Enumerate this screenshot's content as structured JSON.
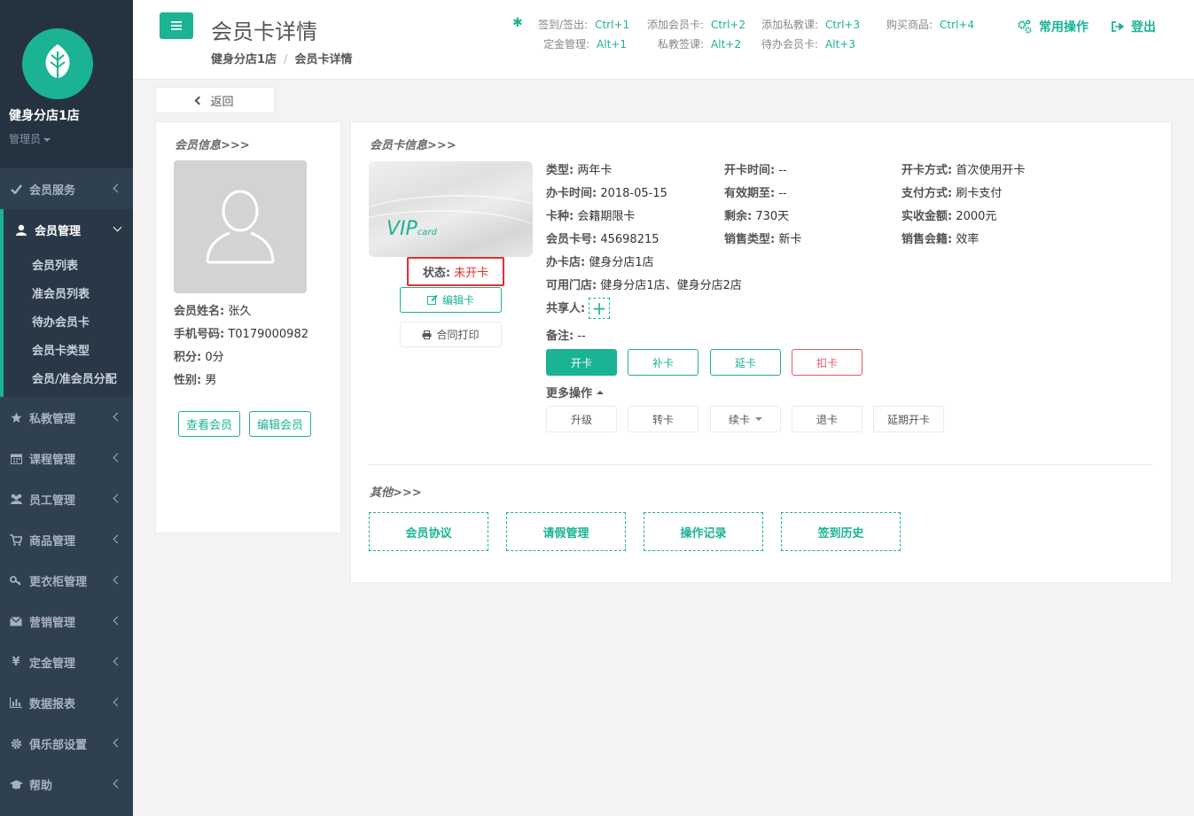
{
  "sidebar": {
    "store_name": "健身分店1店",
    "role": "管理员",
    "items": [
      {
        "label": "会员服务"
      },
      {
        "label": "会员管理"
      },
      {
        "label": "私教管理"
      },
      {
        "label": "课程管理"
      },
      {
        "label": "员工管理"
      },
      {
        "label": "商品管理"
      },
      {
        "label": "更衣柜管理"
      },
      {
        "label": "营销管理"
      },
      {
        "label": "定金管理"
      },
      {
        "label": "数据报表"
      },
      {
        "label": "俱乐部设置"
      },
      {
        "label": "帮助"
      }
    ],
    "member_sub": [
      "会员列表",
      "准会员列表",
      "待办会员卡",
      "会员卡类型",
      "会员/准会员分配"
    ]
  },
  "header": {
    "title": "会员卡详情",
    "breadcrumb": [
      "健身分店1店",
      "/",
      "会员卡详情"
    ],
    "shortcuts": [
      {
        "label": "签到/签出:",
        "key": "Ctrl+1"
      },
      {
        "label": "添加会员卡:",
        "key": "Ctrl+2"
      },
      {
        "label": "添加私教课:",
        "key": "Ctrl+3"
      },
      {
        "label": "购买商品:",
        "key": "Ctrl+4"
      },
      {
        "label": "定金管理:",
        "key": "Alt+1"
      },
      {
        "label": "私教签课:",
        "key": "Alt+2"
      },
      {
        "label": "待办会员卡:",
        "key": "Alt+3"
      }
    ],
    "common_ops": "常用操作",
    "logout": "登出"
  },
  "back_label": "返回",
  "member": {
    "section_title": "会员信息>>>",
    "name_label": "会员姓名:",
    "name": "张久",
    "phone_label": "手机号码:",
    "phone": "T0179000982",
    "points_label": "积分:",
    "points": "0分",
    "gender_label": "性别:",
    "gender": "男",
    "view_btn": "查看会员",
    "edit_btn": "编辑会员"
  },
  "card": {
    "section_title": "会员卡信息>>>",
    "vip_text": "VIP",
    "vip_sub": "card",
    "status_label": "状态:",
    "status": "未开卡",
    "edit_btn": "编辑卡",
    "print_btn": "合同打印",
    "fields": {
      "type": {
        "label": "类型:",
        "value": "两年卡"
      },
      "open_time": {
        "label": "开卡时间:",
        "value": "--"
      },
      "open_mode": {
        "label": "开卡方式:",
        "value": "首次使用开卡"
      },
      "issue_time": {
        "label": "办卡时间:",
        "value": "2018-05-15"
      },
      "valid_until": {
        "label": "有效期至:",
        "value": "--"
      },
      "pay_mode": {
        "label": "支付方式:",
        "value": "刷卡支付"
      },
      "kind": {
        "label": "卡种:",
        "value": "会籍期限卡"
      },
      "remaining": {
        "label": "剩余:",
        "value": "730天"
      },
      "amount": {
        "label": "实收金额:",
        "value": "2000元"
      },
      "card_no": {
        "label": "会员卡号:",
        "value": "45698215"
      },
      "sale_type": {
        "label": "销售类型:",
        "value": "新卡"
      },
      "sales_rep": {
        "label": "销售会籍:",
        "value": "效率"
      },
      "issue_store": {
        "label": "办卡店:",
        "value": "健身分店1店"
      },
      "stores": {
        "label": "可用门店:",
        "value": "健身分店1店、健身分店2店"
      },
      "sharer": {
        "label": "共享人:"
      },
      "remark": {
        "label": "备注:",
        "value": "--"
      }
    },
    "actions": [
      "开卡",
      "补卡",
      "延卡",
      "扣卡"
    ],
    "more_ops": "更多操作",
    "more_actions": [
      "升级",
      "转卡",
      "续卡",
      "退卡",
      "延期开卡"
    ]
  },
  "other": {
    "section_title": "其他>>>",
    "buttons": [
      "会员协议",
      "请假管理",
      "操作记录",
      "签到历史"
    ]
  },
  "colors": {
    "accent": "#1ab394",
    "sidebar": "#2f4050",
    "danger": "#e52d2d"
  }
}
